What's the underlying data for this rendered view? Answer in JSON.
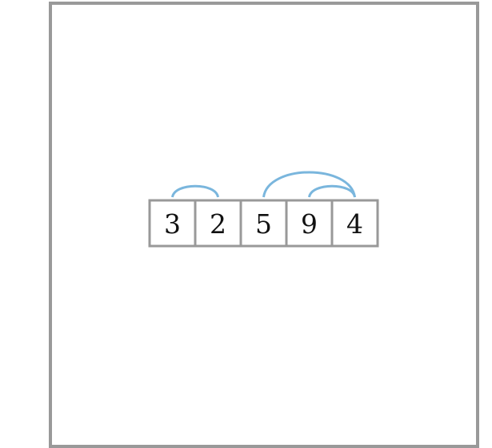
{
  "sequence": {
    "cells": [
      "3",
      "2",
      "5",
      "9",
      "4"
    ],
    "arcs": [
      {
        "from": 0,
        "to": 1
      },
      {
        "from": 3,
        "to": 4
      },
      {
        "from": 2,
        "to": 4
      }
    ]
  },
  "colors": {
    "frame": "#999999",
    "cell_border": "#999999",
    "arc": "#7ab6dd",
    "text": "#111111",
    "background": "#ffffff"
  }
}
